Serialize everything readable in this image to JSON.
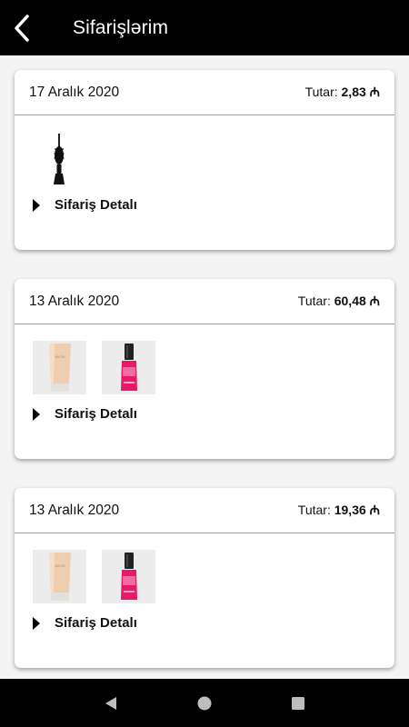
{
  "header": {
    "title": "Sifarişlərim",
    "back_icon": "back-chevron-icon"
  },
  "orders": [
    {
      "date": "17 Aralık 2020",
      "total_label": "Tutar:",
      "total_value": "2,83 ₼",
      "products": [
        {
          "icon": "mascara-icon"
        }
      ],
      "detail_label": "Sifariş Detalı"
    },
    {
      "date": "13 Aralık 2020",
      "total_label": "Tutar:",
      "total_value": "60,48 ₼",
      "products": [
        {
          "icon": "cream-tube-icon"
        },
        {
          "icon": "nail-polish-icon"
        }
      ],
      "detail_label": "Sifariş Detalı"
    },
    {
      "date": "13 Aralık 2020",
      "total_label": "Tutar:",
      "total_value": "19,36 ₼",
      "products": [
        {
          "icon": "cream-tube-icon"
        },
        {
          "icon": "nail-polish-icon"
        }
      ],
      "detail_label": "Sifariş Detalı"
    }
  ],
  "navigation": {
    "back": "nav-back-icon",
    "home": "nav-home-icon",
    "recents": "nav-recents-icon"
  },
  "colors": {
    "bar": "#000000",
    "background": "#f4f4f4",
    "polish": "#e8196b",
    "cream": "#ecc7a8"
  }
}
